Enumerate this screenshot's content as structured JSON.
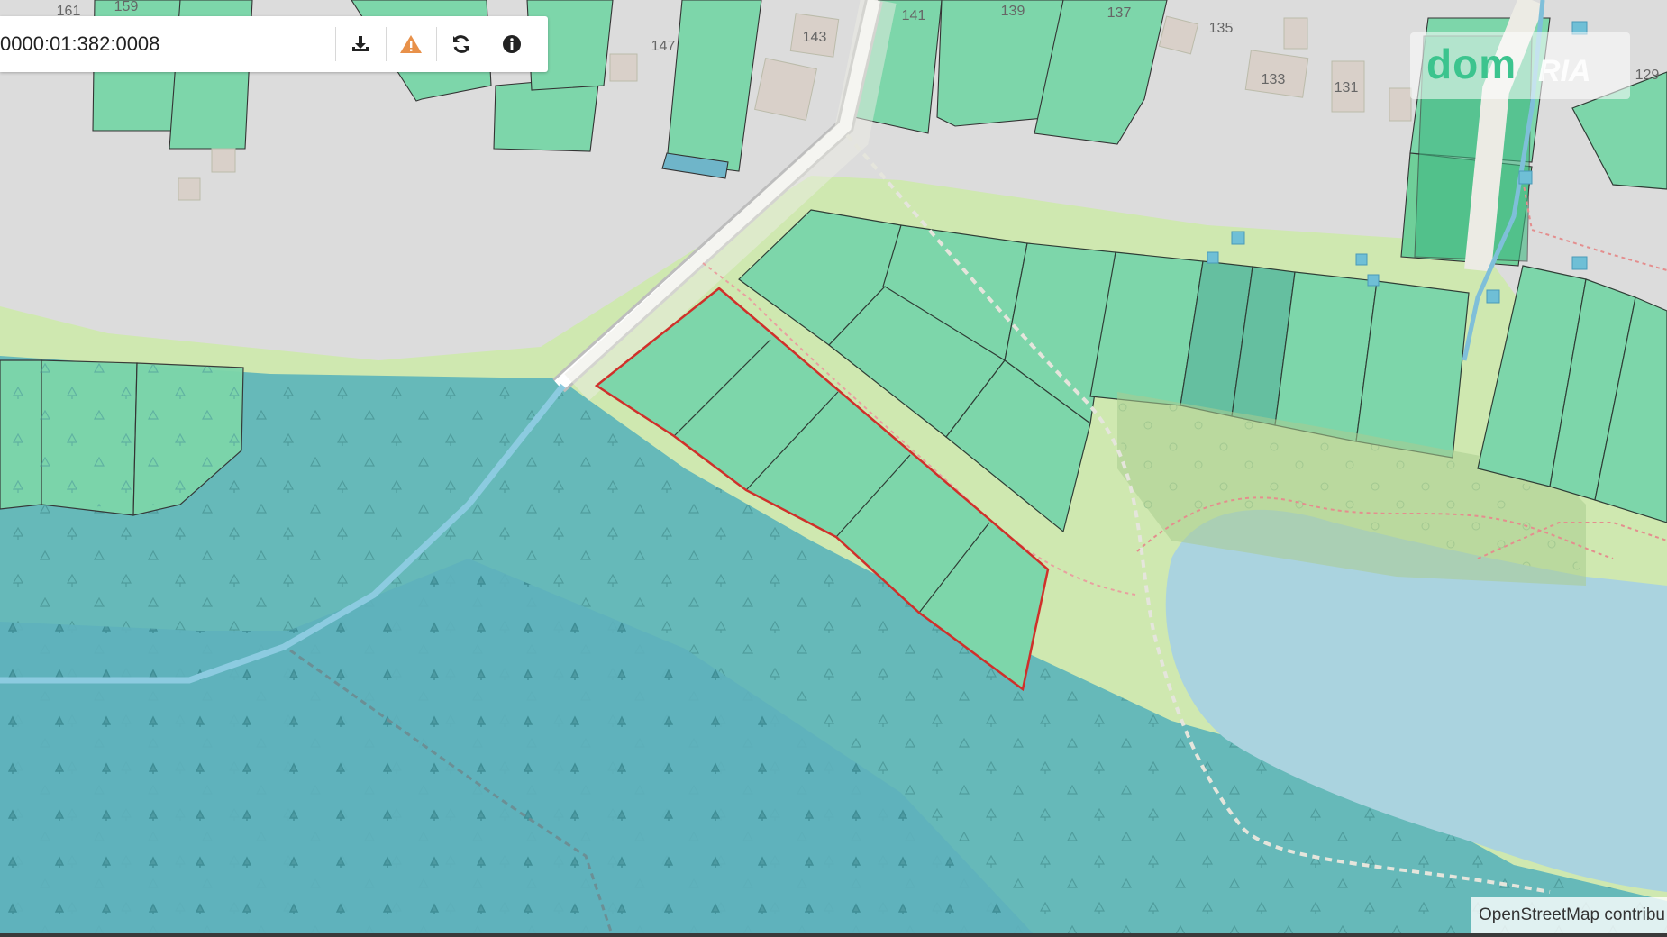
{
  "toolbar": {
    "cadastral_number": "0000:01:382:0008",
    "buttons": [
      {
        "icon": "download-icon",
        "color": "#222222"
      },
      {
        "icon": "warning-icon",
        "color": "#e8914a"
      },
      {
        "icon": "refresh-icon",
        "color": "#222222"
      },
      {
        "icon": "info-icon",
        "color": "#222222"
      }
    ]
  },
  "map": {
    "building_numbers": [
      "161",
      "159",
      "147",
      "143",
      "141",
      "139",
      "137",
      "135",
      "133",
      "131",
      "129"
    ],
    "colors": {
      "base": "#dcdcdc",
      "parcel": "#7dd6aa",
      "parcel_dark": "#65bfa0",
      "forest": "#66b9b9",
      "park": "#cfe8b0",
      "water": "#aad3df",
      "road": "#ffffff",
      "selected_outline": "#d0302a",
      "building": "#d9d0c9"
    }
  },
  "watermark": {
    "brand": "dom",
    "brand_suffix": "RIA"
  },
  "attribution": "OpenStreetMap contribu"
}
